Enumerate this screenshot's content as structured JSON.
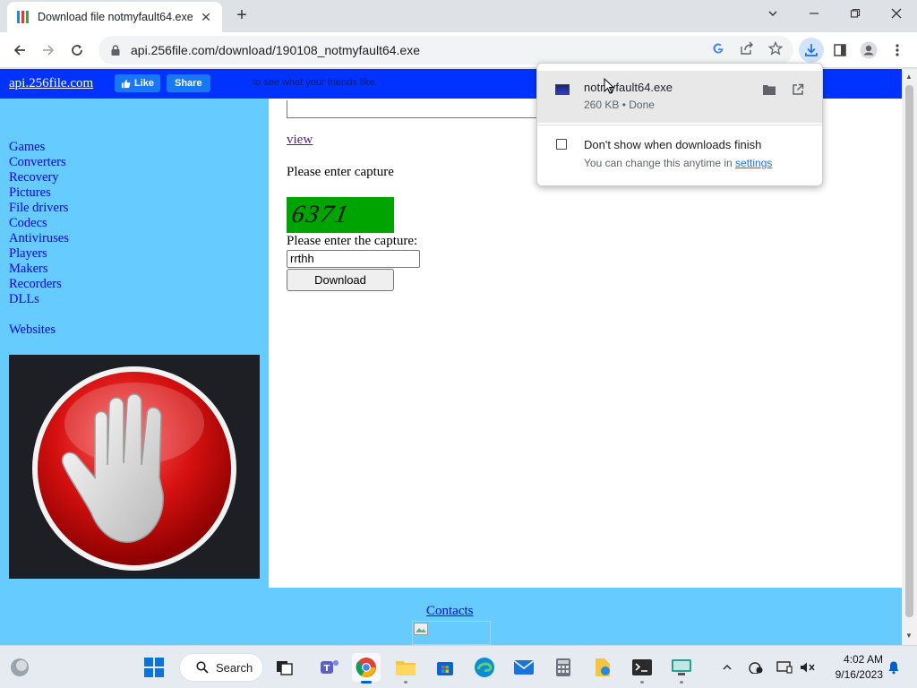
{
  "browser": {
    "tab_title": "Download file notmyfault64.exe",
    "tab_close": "✕",
    "new_tab": "+",
    "url": "api.256file.com/download/190108_notmyfault64.exe"
  },
  "page": {
    "site_link": "api.256file.com",
    "fb_like": "Like",
    "fb_share": "Share",
    "fb_text": "to see what your friends like.",
    "sidebar_links": [
      "Games",
      "Converters",
      "Recovery",
      "Pictures",
      "File drivers",
      "Codecs",
      "Antiviruses",
      "Players",
      "Makers",
      "Recorders",
      "DLLs"
    ],
    "websites": "Websites",
    "view_link": "view",
    "enter_capture": "Please enter capture",
    "captcha_code": "6371",
    "enter_capture2": "Please enter the capture:",
    "capture_value": "rrthh",
    "download_button": "Download",
    "contacts": "Contacts"
  },
  "download_bubble": {
    "file_name": "notmyfault64.exe",
    "status": "260 KB • Done",
    "dont_show": "Don't show when downloads finish",
    "note_prefix": "You can change this anytime in ",
    "note_link": "settings"
  },
  "taskbar": {
    "search_label": "Search",
    "time": "4:02 AM",
    "date": "9/16/2023"
  },
  "colors": {
    "page_header": "#0033ff",
    "sidebar": "#66ccff",
    "captcha_bg": "#00a400"
  }
}
